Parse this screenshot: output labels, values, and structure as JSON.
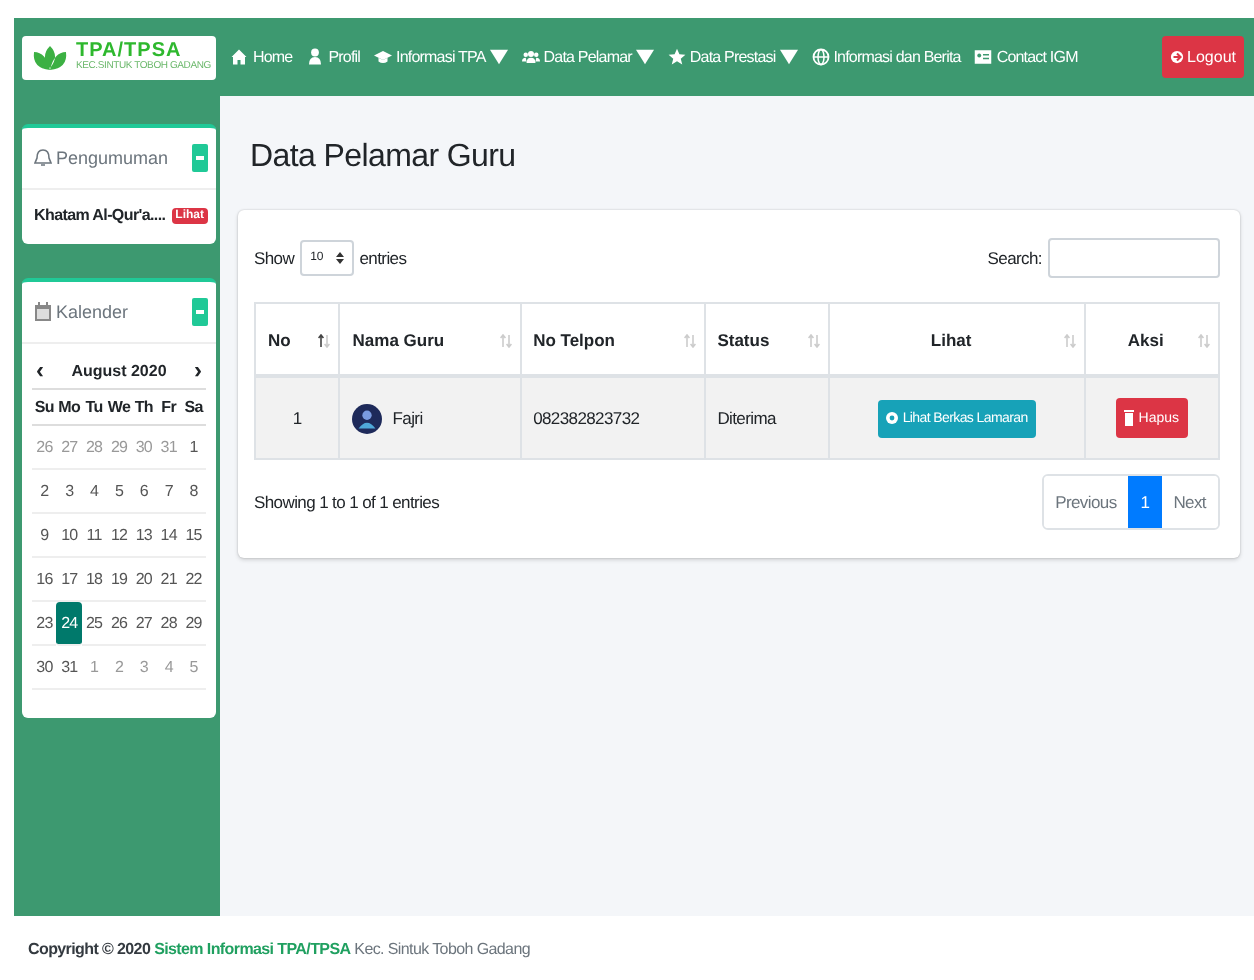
{
  "brand": {
    "name": "TPA/TPSA",
    "subtitle": "KEC.SINTUK TOBOH GADANG"
  },
  "nav": [
    {
      "label": "Home",
      "dropdown": false
    },
    {
      "label": "Profil",
      "dropdown": false
    },
    {
      "label": "Informasi TPA",
      "dropdown": true
    },
    {
      "label": "Data Pelamar",
      "dropdown": true
    },
    {
      "label": "Data Prestasi",
      "dropdown": true
    },
    {
      "label": "Informasi dan Berita",
      "dropdown": false
    },
    {
      "label": "Contact IGM",
      "dropdown": false
    }
  ],
  "logout": "Logout",
  "announcement": {
    "title": "Pengumuman",
    "item": "Khatam Al-Qur'a....",
    "badge": "Lihat"
  },
  "calendar": {
    "title": "Kalender",
    "prev": "‹",
    "month": "August 2020",
    "next": "›",
    "weekdays": [
      "Su",
      "Mo",
      "Tu",
      "We",
      "Th",
      "Fr",
      "Sa"
    ],
    "weeks": [
      [
        {
          "day": "26",
          "other_month": true,
          "selected": false
        },
        {
          "day": "27",
          "other_month": true,
          "selected": false
        },
        {
          "day": "28",
          "other_month": true,
          "selected": false
        },
        {
          "day": "29",
          "other_month": true,
          "selected": false
        },
        {
          "day": "30",
          "other_month": true,
          "selected": false
        },
        {
          "day": "31",
          "other_month": true,
          "selected": false
        },
        {
          "day": "1",
          "other_month": false,
          "selected": false
        }
      ],
      [
        {
          "day": "2",
          "other_month": false,
          "selected": false
        },
        {
          "day": "3",
          "other_month": false,
          "selected": false
        },
        {
          "day": "4",
          "other_month": false,
          "selected": false
        },
        {
          "day": "5",
          "other_month": false,
          "selected": false
        },
        {
          "day": "6",
          "other_month": false,
          "selected": false
        },
        {
          "day": "7",
          "other_month": false,
          "selected": false
        },
        {
          "day": "8",
          "other_month": false,
          "selected": false
        }
      ],
      [
        {
          "day": "9",
          "other_month": false,
          "selected": false
        },
        {
          "day": "10",
          "other_month": false,
          "selected": false
        },
        {
          "day": "11",
          "other_month": false,
          "selected": false
        },
        {
          "day": "12",
          "other_month": false,
          "selected": false
        },
        {
          "day": "13",
          "other_month": false,
          "selected": false
        },
        {
          "day": "14",
          "other_month": false,
          "selected": false
        },
        {
          "day": "15",
          "other_month": false,
          "selected": false
        }
      ],
      [
        {
          "day": "16",
          "other_month": false,
          "selected": false
        },
        {
          "day": "17",
          "other_month": false,
          "selected": false
        },
        {
          "day": "18",
          "other_month": false,
          "selected": false
        },
        {
          "day": "19",
          "other_month": false,
          "selected": false
        },
        {
          "day": "20",
          "other_month": false,
          "selected": false
        },
        {
          "day": "21",
          "other_month": false,
          "selected": false
        },
        {
          "day": "22",
          "other_month": false,
          "selected": false
        }
      ],
      [
        {
          "day": "23",
          "other_month": false,
          "selected": false
        },
        {
          "day": "24",
          "other_month": false,
          "selected": true
        },
        {
          "day": "25",
          "other_month": false,
          "selected": false
        },
        {
          "day": "26",
          "other_month": false,
          "selected": false
        },
        {
          "day": "27",
          "other_month": false,
          "selected": false
        },
        {
          "day": "28",
          "other_month": false,
          "selected": false
        },
        {
          "day": "29",
          "other_month": false,
          "selected": false
        }
      ],
      [
        {
          "day": "30",
          "other_month": false,
          "selected": false
        },
        {
          "day": "31",
          "other_month": false,
          "selected": false
        },
        {
          "day": "1",
          "other_month": true,
          "selected": false
        },
        {
          "day": "2",
          "other_month": true,
          "selected": false
        },
        {
          "day": "3",
          "other_month": true,
          "selected": false
        },
        {
          "day": "4",
          "other_month": true,
          "selected": false
        },
        {
          "day": "5",
          "other_month": true,
          "selected": false
        }
      ]
    ]
  },
  "page_title": "Data Pelamar Guru",
  "table": {
    "show_label": "Show",
    "page_size": "10",
    "entries_label": "entries",
    "search_label": "Search:",
    "columns": [
      {
        "label": "No",
        "sorted": true
      },
      {
        "label": "Nama Guru",
        "sorted": false
      },
      {
        "label": "No Telpon",
        "sorted": false
      },
      {
        "label": "Status",
        "sorted": false
      },
      {
        "label": "Lihat",
        "sorted": false
      },
      {
        "label": "Aksi",
        "sorted": false
      }
    ],
    "rows": [
      {
        "no": "1",
        "name": "Fajri",
        "phone": "082382823732",
        "status": "Diterima",
        "view_button": "Lihat Berkas Lamaran",
        "delete_button": "Hapus"
      }
    ],
    "info": "Showing 1 to 1 of 1 entries",
    "pagination": [
      {
        "label": "Previous",
        "selected": false
      },
      {
        "label": "1",
        "selected": true
      },
      {
        "label": "Next",
        "selected": false
      }
    ]
  },
  "footer": {
    "prefix": "Copyright © 2020",
    "link": "Sistem Informasi TPA/TPSA",
    "suffix": "Kec. Sintuk Toboh Gadang"
  }
}
